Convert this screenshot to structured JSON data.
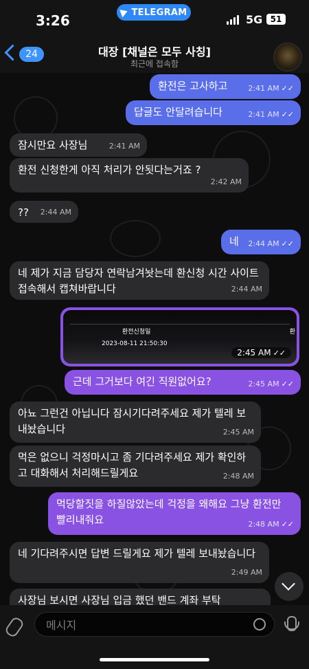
{
  "status": {
    "time": "3:26",
    "telegram_label": "TELEGRAM",
    "network": "5G",
    "battery": "51"
  },
  "header": {
    "back_count": "24",
    "title": "대장 [채널은 모두 사칭]",
    "subtitle": "최근에 접속함"
  },
  "messages": [
    {
      "side": "out",
      "text": "환전은 고사하고",
      "time": "2:41 AM"
    },
    {
      "side": "out",
      "text": "답글도 안달려습니다",
      "time": "2:41 AM"
    },
    {
      "side": "in",
      "text": "잠시만요 사장님",
      "time": "2:41 AM"
    },
    {
      "side": "in",
      "text": "환전 신청한게 아직 처리가 안됫다는거죠 ?",
      "time": "2:42 AM"
    },
    {
      "side": "in",
      "text": "??",
      "time": "2:44 AM"
    },
    {
      "side": "out",
      "text": "네",
      "time": "2:44 AM"
    },
    {
      "side": "in",
      "text": "네 제가 지금 담당자 연락남겨놧는데 환신청 시간 사이트 접속해서 캡쳐바랍니다",
      "time": "2:44 AM"
    },
    {
      "side": "out",
      "type": "image",
      "time": "2:45 AM",
      "image_text": {
        "header": "환전신청일",
        "datetime": "2023-08-11 21:50:30",
        "right": "환"
      }
    },
    {
      "side": "out",
      "text": "근데 그거보다 여긴 직원없어요?",
      "time": "2:45 AM"
    },
    {
      "side": "in",
      "text": "아뇨 그런건 아닙니다 잠시기다려주세요 제가 텔레 보내놨습니다",
      "time": "2:45 AM"
    },
    {
      "side": "in",
      "text": "먹은 없으니 걱정마시고 좀 기다려주세요 제가 확인하고 대화해서 처리해드릴게요",
      "time": "2:48 AM"
    },
    {
      "side": "out",
      "text": "먹당할짓을 하질않았는데 걱정을 왜해요 그냥 환전만 빨리내줘요",
      "time": "2:48 AM"
    },
    {
      "side": "in",
      "text": "네 기다려주시면 답변 드릴게요 제가 텔레 보내놨습니다",
      "time": "2:49 AM"
    },
    {
      "side": "in",
      "text": "사장님 보시면 사장님 입금 했던 밴드 계좌 부탁",
      "time": ""
    }
  ],
  "input": {
    "placeholder": "메시지"
  }
}
